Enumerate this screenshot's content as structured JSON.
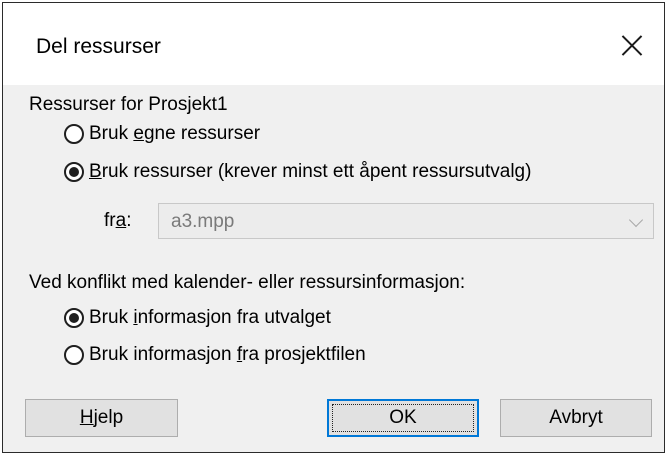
{
  "window": {
    "title": "Del ressurser"
  },
  "resources_group": {
    "label": "Ressurser for Prosjekt1",
    "options": [
      {
        "pre": "Bruk ",
        "ul": "e",
        "post": "gne ressurser",
        "selected": false
      },
      {
        "pre": "",
        "ul": "B",
        "post": "ruk ressurser (krever minst ett åpent ressursutvalg)",
        "selected": true
      }
    ],
    "from": {
      "pre": "fr",
      "ul": "a",
      "post": ":",
      "value": "a3.mpp",
      "enabled": false
    }
  },
  "conflict_group": {
    "label": "Ved konflikt med kalender- eller ressursinformasjon:",
    "options": [
      {
        "pre": "Bruk ",
        "ul": "i",
        "post": "nformasjon fra utvalget",
        "selected": true
      },
      {
        "pre": "Bruk informasjon ",
        "ul": "f",
        "post": "ra prosjektfilen",
        "selected": false
      }
    ]
  },
  "buttons": {
    "help": {
      "pre": "",
      "ul": "H",
      "post": "jelp"
    },
    "ok": "OK",
    "cancel": "Avbryt"
  }
}
